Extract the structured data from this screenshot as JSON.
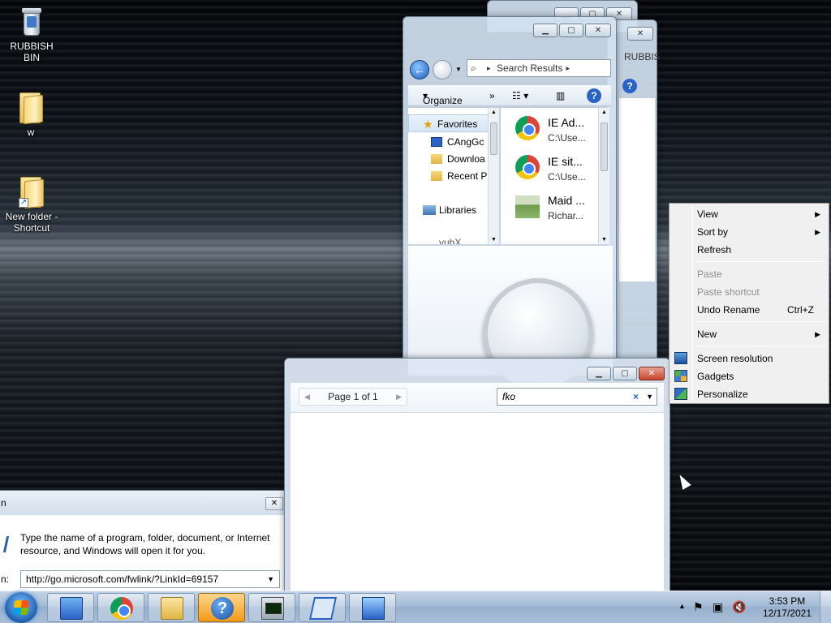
{
  "desktop": {
    "icons": [
      {
        "label": "RUBBISH BIN"
      },
      {
        "label": "w"
      },
      {
        "label": "New folder - Shortcut"
      }
    ]
  },
  "explorer": {
    "address": "Search Results",
    "back_window_tab": "RUBBIS",
    "toolbar": {
      "organize": "Organize",
      "more": "»"
    },
    "nav": {
      "favorites": "Favorites",
      "items": [
        "CAngGc",
        "Downloa",
        "Recent P"
      ],
      "libraries": "Libraries",
      "partial": "vubX"
    },
    "files": [
      {
        "title": "IE Ad...",
        "sub": "C:\\Use..."
      },
      {
        "title": "IE sit...",
        "sub": "C:\\Use..."
      },
      {
        "title": "Maid ...",
        "sub": "Richar..."
      }
    ]
  },
  "viewer": {
    "pager": "Page 1 of 1",
    "search_value": "fko",
    "clear": "×"
  },
  "run_dialog": {
    "title_fragment": "n",
    "description": "Type the name of a program, folder, document, or Internet resource, and Windows will open it for you.",
    "open_label": "n:",
    "value": "http://go.microsoft.com/fwlink/?LinkId=69157"
  },
  "context_menu": {
    "items": [
      {
        "label": "View",
        "submenu": true
      },
      {
        "label": "Sort by",
        "submenu": true
      },
      {
        "label": "Refresh"
      },
      {
        "label": "Paste",
        "disabled": true
      },
      {
        "label": "Paste shortcut",
        "disabled": true
      },
      {
        "label": "Undo Rename",
        "accel": "Ctrl+Z"
      },
      {
        "label": "New",
        "submenu": true
      },
      {
        "label": "Screen resolution",
        "icon": "monitor-icon"
      },
      {
        "label": "Gadgets",
        "icon": "gadgets-icon"
      },
      {
        "label": "Personalize",
        "icon": "personalize-icon"
      }
    ]
  },
  "taskbar": {
    "time": "3:53 PM",
    "date": "12/17/2021",
    "buttons": [
      "control-panel-icon",
      "chrome-icon",
      "explorer-folder-icon",
      "help-icon",
      "task-manager-icon",
      "window-icon",
      "display-icon"
    ]
  }
}
